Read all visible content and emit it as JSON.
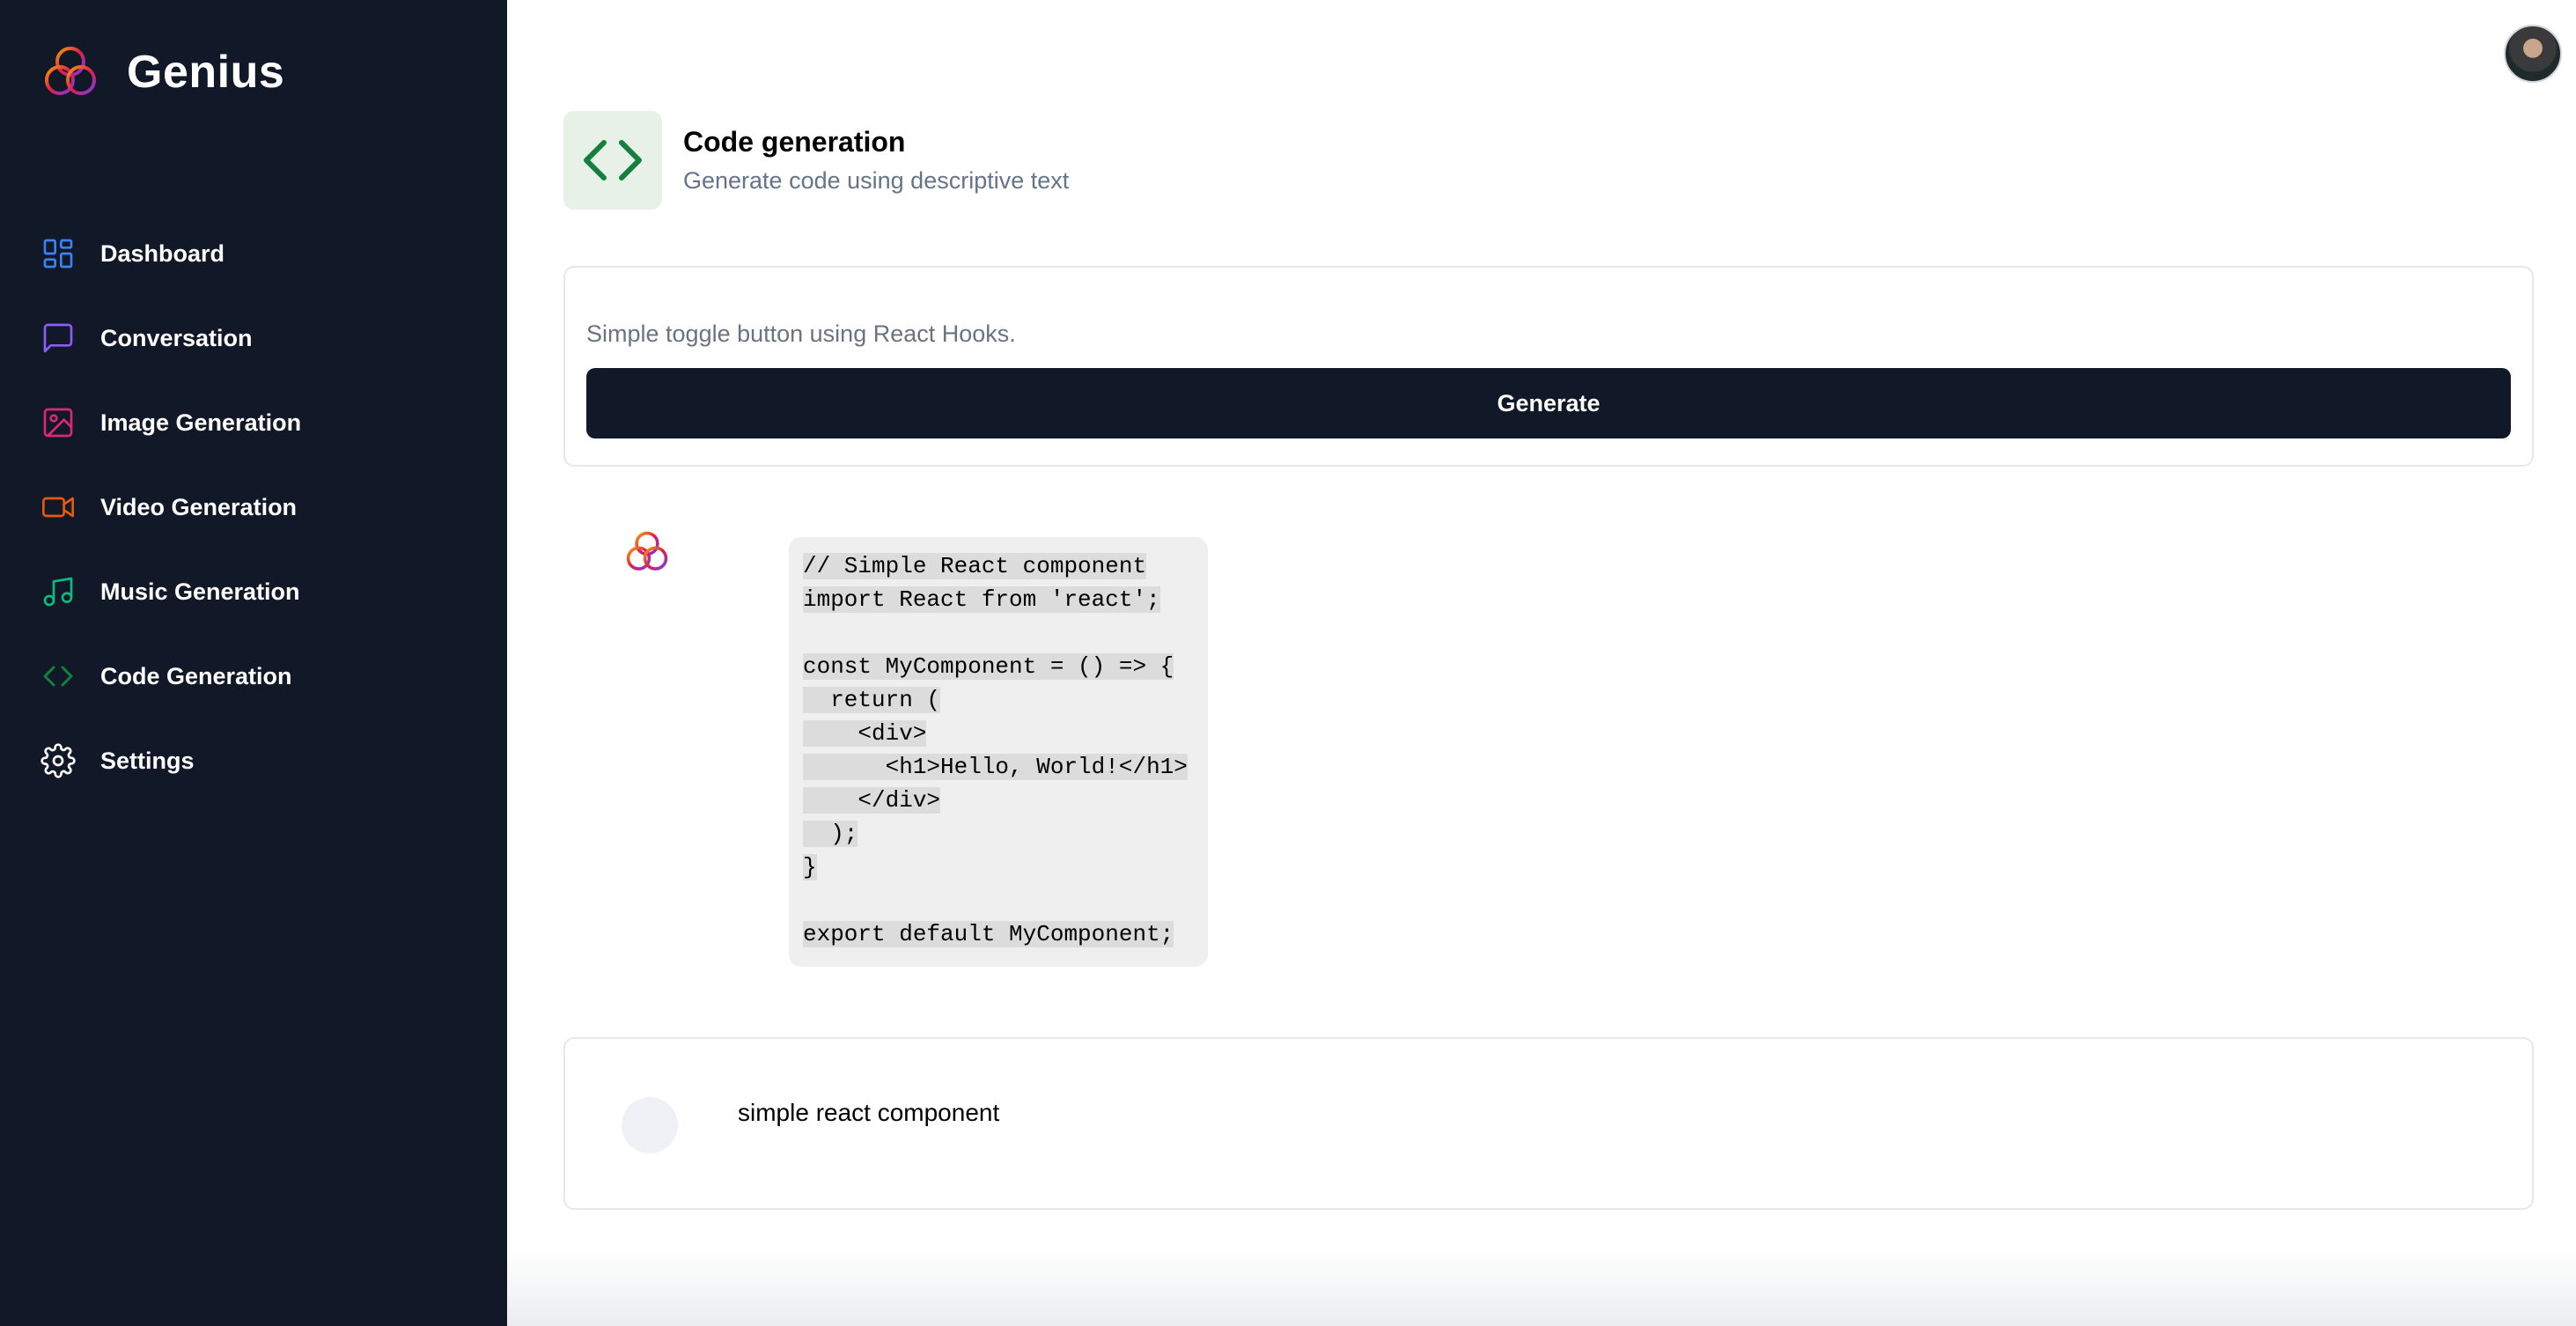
{
  "brand": {
    "name": "Genius"
  },
  "sidebar": {
    "items": [
      {
        "label": "Dashboard",
        "icon": "dashboard-icon",
        "color": "#3b82f6"
      },
      {
        "label": "Conversation",
        "icon": "message-square-icon",
        "color": "#8b5cf6"
      },
      {
        "label": "Image Generation",
        "icon": "image-icon",
        "color": "#db2777"
      },
      {
        "label": "Video Generation",
        "icon": "video-icon",
        "color": "#ea580c"
      },
      {
        "label": "Music Generation",
        "icon": "music-icon",
        "color": "#10b981"
      },
      {
        "label": "Code Generation",
        "icon": "code-icon",
        "color": "#15803d"
      },
      {
        "label": "Settings",
        "icon": "settings-icon",
        "color": "#ffffff"
      }
    ]
  },
  "heading": {
    "title": "Code generation",
    "description": "Generate code using descriptive text",
    "icon": "code-icon",
    "icon_color": "#15803d",
    "icon_bg": "#e7f1e7"
  },
  "form": {
    "prompt_placeholder": "Simple toggle button using React Hooks.",
    "prompt_value": "",
    "generate_label": "Generate"
  },
  "messages": [
    {
      "role": "bot",
      "code_lines": [
        "// Simple React component",
        "import React from 'react';",
        "",
        "const MyComponent = () => {",
        "  return (",
        "    <div>",
        "      <h1>Hello, World!</h1>",
        "    </div>",
        "  );",
        "}",
        "",
        "export default MyComponent;"
      ]
    },
    {
      "role": "user",
      "text": "simple react component"
    }
  ],
  "colors": {
    "sidebar_bg": "#111827",
    "button_bg": "#111827",
    "code_bg": "#efefef"
  }
}
